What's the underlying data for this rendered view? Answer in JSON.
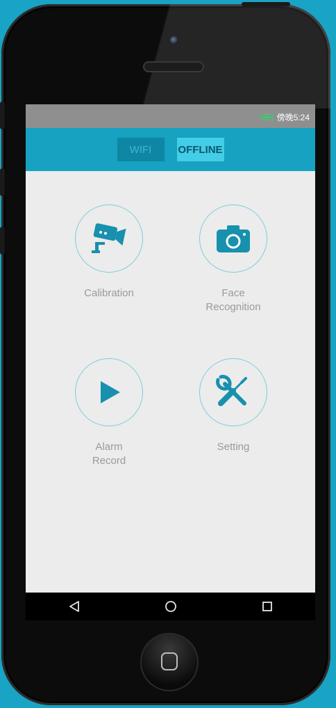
{
  "status_bar": {
    "time": "傍晚5:24"
  },
  "tabs": [
    {
      "label": "WIFI",
      "active": false
    },
    {
      "label": "OFFLINE",
      "active": true
    }
  ],
  "menu": [
    {
      "label": "Calibration",
      "icon": "security-camera-icon"
    },
    {
      "label": "Face\nRecognition",
      "icon": "camera-icon"
    },
    {
      "label": "Alarm\nRecord",
      "icon": "play-icon"
    },
    {
      "label": "Setting",
      "icon": "wrench-screwdriver-icon"
    }
  ],
  "nav": {
    "back": "back-icon",
    "home": "home-icon",
    "recents": "recents-icon"
  },
  "colors": {
    "accent": "#16a2c0",
    "icon": "#1791ad",
    "background": "#ececec"
  }
}
